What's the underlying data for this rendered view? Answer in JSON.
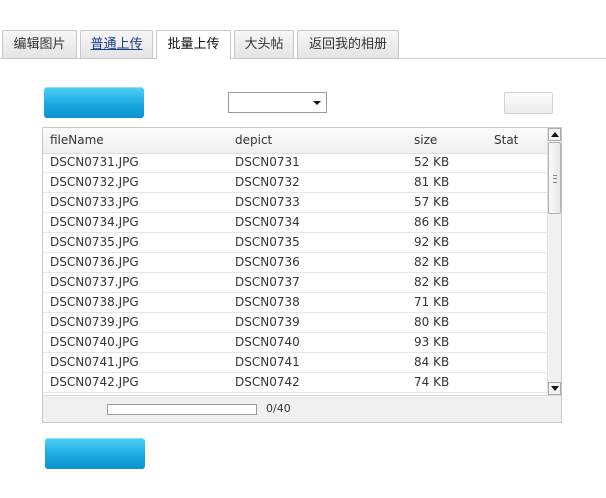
{
  "tabs": [
    {
      "label": "编辑图片",
      "style": "plain"
    },
    {
      "label": "普通上传",
      "style": "link"
    },
    {
      "label": "批量上传",
      "style": "active"
    },
    {
      "label": "大头帖",
      "style": "plain"
    },
    {
      "label": "返回我的相册",
      "style": "plain"
    }
  ],
  "grid": {
    "columns": [
      "fileName",
      "depict",
      "size",
      "Stat"
    ],
    "rows": [
      {
        "file": "DSCN0731.JPG",
        "depict": "DSCN0731",
        "size": "52 KB",
        "stat": ""
      },
      {
        "file": "DSCN0732.JPG",
        "depict": "DSCN0732",
        "size": "81 KB",
        "stat": ""
      },
      {
        "file": "DSCN0733.JPG",
        "depict": "DSCN0733",
        "size": "57 KB",
        "stat": ""
      },
      {
        "file": "DSCN0734.JPG",
        "depict": "DSCN0734",
        "size": "86 KB",
        "stat": ""
      },
      {
        "file": "DSCN0735.JPG",
        "depict": "DSCN0735",
        "size": "92 KB",
        "stat": ""
      },
      {
        "file": "DSCN0736.JPG",
        "depict": "DSCN0736",
        "size": "82 KB",
        "stat": ""
      },
      {
        "file": "DSCN0737.JPG",
        "depict": "DSCN0737",
        "size": "82 KB",
        "stat": ""
      },
      {
        "file": "DSCN0738.JPG",
        "depict": "DSCN0738",
        "size": "71 KB",
        "stat": ""
      },
      {
        "file": "DSCN0739.JPG",
        "depict": "DSCN0739",
        "size": "80 KB",
        "stat": ""
      },
      {
        "file": "DSCN0740.JPG",
        "depict": "DSCN0740",
        "size": "93 KB",
        "stat": ""
      },
      {
        "file": "DSCN0741.JPG",
        "depict": "DSCN0741",
        "size": "84 KB",
        "stat": ""
      },
      {
        "file": "DSCN0742.JPG",
        "depict": "DSCN0742",
        "size": "74 KB",
        "stat": ""
      }
    ]
  },
  "status": {
    "progress_text": "0/40",
    "progress_fraction": 0
  },
  "dropdown": {
    "selected": ""
  },
  "colors": {
    "accent": "#1aa9e0",
    "tab_link": "#1a3e8c",
    "border": "#c8c8c8"
  }
}
